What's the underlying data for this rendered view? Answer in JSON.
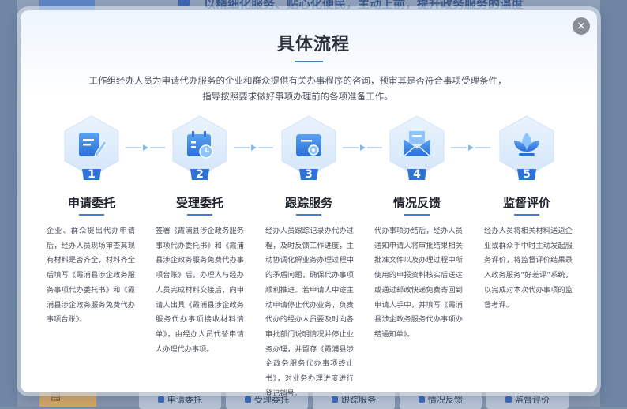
{
  "background": {
    "header_text": "以精细化服务、贴心化便民，主动上前，提升政务服务的温度",
    "corner_icon": "document-icon",
    "tabs": [
      "申请委托",
      "受理委托",
      "跟踪服务",
      "情况反馈",
      "监督评价"
    ]
  },
  "modal": {
    "title": "具体流程",
    "close_label": "×",
    "intro": "工作组经办人员为申请代办服务的企业和群众提供有关办事程序的咨询，预审其是否符合事项受理条件，指导按照要求做好事项办理前的各项准备工作。",
    "accent_color": "#3e7ed6",
    "steps": [
      {
        "number": "1",
        "icon": "edit-document-icon",
        "title": "申请委托",
        "description": "企业、群众提出代办申请后，经办人员现场审查其现有材料是否齐全，材料齐全后填写《霞浦县涉企政务服务事项代办委托书》和《霞浦县涉企政务服务免费代办事项台账》。"
      },
      {
        "number": "2",
        "icon": "calendar-clock-icon",
        "title": "受理委托",
        "description": "签署《霞浦县涉企政务服务事项代办委托书》和《霞浦县涉企政务服务免费代办事项台账》后，办理人与经办人员完成材料交接后，向申请人出具《霞浦县涉企政务服务代办事项接收材料清单》，由经办人员代替申请人办理代办事项。"
      },
      {
        "number": "3",
        "icon": "tracking-icon",
        "title": "跟踪服务",
        "description": "经办人员跟踪记录办代办过程，及时反馈工作进度，主动协调化解业务办理过程中的矛盾问题，确保代办事项顺利推进。若申请人中途主动申请停止代办业务，负责代办的经办人员要及时向各审批部门说明情况并停止业务办理，并留存《霞浦县涉企政务服务代办事项终止书》，对业务办理进度进行登记销号。"
      },
      {
        "number": "4",
        "icon": "envelope-icon",
        "title": "情况反馈",
        "description": "代办事项办结后，经办人员通知申请人将审批结果相关批准文件以及办理过程中所使用的申报资料核实后送达或通过邮政快递免费寄回到申请人手中，并填写《霞浦县涉企政务服务代办事项办结通知单》。"
      },
      {
        "number": "5",
        "icon": "lotus-icon",
        "title": "监督评价",
        "description": "经办人员将相关材料送返企业或群众手中时主动发起服务评价，将监督评价结果录入政务服务“好差评”系统，以完成对本次代办事项的监督考评。"
      }
    ]
  }
}
